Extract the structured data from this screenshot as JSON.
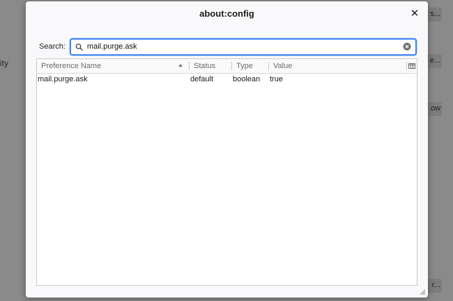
{
  "background": {
    "partial_text": "ity",
    "buttons": [
      "s...",
      "e...",
      "ow",
      "r..."
    ]
  },
  "dialog": {
    "title": "about:config",
    "close_glyph": "✕"
  },
  "search": {
    "label": "Search:",
    "value": "mail.purge.ask",
    "placeholder": ""
  },
  "table": {
    "columns": [
      "Preference Name",
      "Status",
      "Type",
      "Value"
    ],
    "sort_column": "Preference Name",
    "sort_direction": "ascending",
    "rows": [
      {
        "name": "mail.purge.ask",
        "status": "default",
        "type": "boolean",
        "value": "true"
      }
    ]
  },
  "icons": {
    "search": "search-icon",
    "clear": "clear-icon",
    "close": "close-icon",
    "column_picker": "column-picker-icon",
    "resize": "resize-grip-icon"
  },
  "colors": {
    "focus_ring": "#3e84f6",
    "backdrop": "#8a8a8a",
    "dialog_bg": "#f9f9fb"
  }
}
